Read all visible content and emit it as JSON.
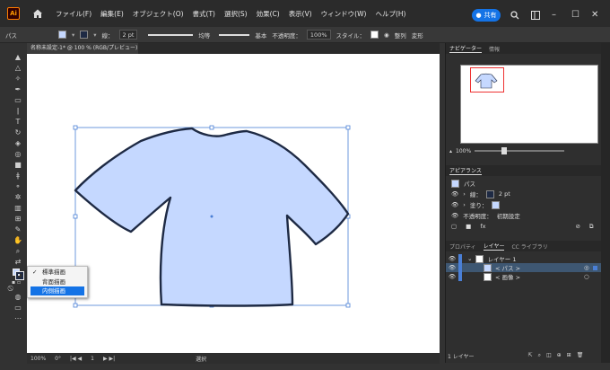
{
  "menubar": {
    "app_icon": "Ai",
    "items": [
      "ファイル(F)",
      "編集(E)",
      "オブジェクト(O)",
      "書式(T)",
      "選択(S)",
      "効果(C)",
      "表示(V)",
      "ウィンドウ(W)",
      "ヘルプ(H)"
    ],
    "share_label": "共有"
  },
  "controlbar": {
    "selection_label": "パス",
    "stroke_label": "線：",
    "stroke_value": "2 pt",
    "profile_label": "均等",
    "brush_label": "基本",
    "opacity_label": "不透明度：",
    "opacity_value": "100%",
    "style_label": "スタイル：",
    "align_label": "整列",
    "transform_label": "変形"
  },
  "document": {
    "tab_title": "名称未設定-1* @ 100 % (RGB/プレビュー)"
  },
  "statusbar": {
    "zoom": "100%",
    "rotation": "0°",
    "artboard_num": "1",
    "mode": "選択"
  },
  "popup_menu": {
    "items": [
      "標準描画",
      "背面描画",
      "内側描画"
    ],
    "checked_index": 0,
    "highlighted_index": 2
  },
  "navigator": {
    "tabs": [
      "ナビゲーター",
      "情報"
    ],
    "zoom": "100%"
  },
  "appearance": {
    "title": "アピアランス",
    "object": "パス",
    "stroke_label": "線：",
    "stroke_value": "2 pt",
    "fill_label": "塗り：",
    "opacity_label": "不透明度：",
    "opacity_value": "初期設定"
  },
  "layers": {
    "tabs": [
      "プロパティ",
      "レイヤー",
      "CC ライブラリ"
    ],
    "rows": [
      "レイヤー 1",
      "< パス >",
      "< 画像 >"
    ],
    "footer": "1 レイヤー"
  },
  "colors": {
    "accent": "#1473e6",
    "shirt_fill": "#c5d8ff",
    "shirt_stroke": "#1e2a44",
    "bbox": "#4a7fd6"
  }
}
